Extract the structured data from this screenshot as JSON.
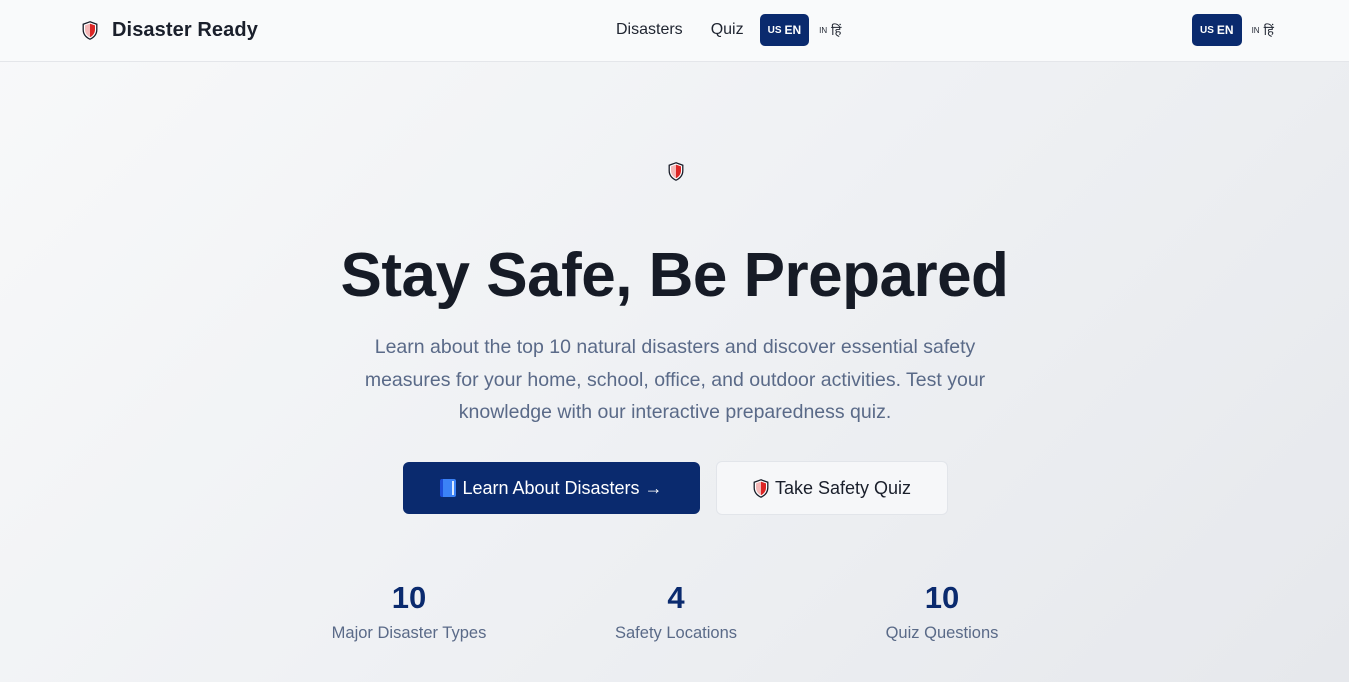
{
  "brand": {
    "title": "Disaster Ready",
    "icon": "shield-icon"
  },
  "nav": {
    "links": [
      "Disasters",
      "Quiz"
    ],
    "lang_primary": {
      "code": "US",
      "label": "EN"
    },
    "lang_secondary": {
      "code": "IN",
      "label": "हिं"
    }
  },
  "hero": {
    "icon": "shield-icon",
    "title": "Stay Safe, Be Prepared",
    "description": "Learn about the top 10 natural disasters and discover essential safety measures for your home, school, office, and outdoor activities. Test your knowledge with our interactive preparedness quiz.",
    "primary_button": "Learn About Disasters →",
    "secondary_button": "Take Safety Quiz"
  },
  "stats": [
    {
      "value": "10",
      "label": "Major Disaster Types"
    },
    {
      "value": "4",
      "label": "Safety Locations"
    },
    {
      "value": "10",
      "label": "Quiz Questions"
    }
  ],
  "colors": {
    "brand_navy": "#0a2a6e",
    "shield_red": "#dc2626",
    "text_dark": "#161b26",
    "text_muted": "#5a6a88"
  }
}
